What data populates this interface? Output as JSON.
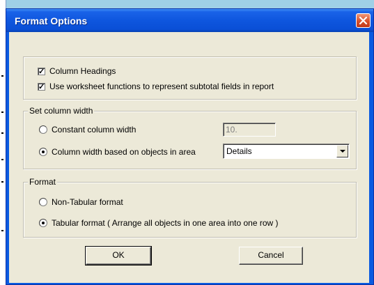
{
  "dialog": {
    "title": "Format Options"
  },
  "options": {
    "column_headings": {
      "label": "Column Headings",
      "checked": true
    },
    "worksheet_functions": {
      "label": "Use worksheet functions to represent subtotal fields in report",
      "checked": true
    }
  },
  "column_width": {
    "legend": "Set column width",
    "constant": {
      "label": "Constant column width",
      "selected": false,
      "value": "10."
    },
    "based_on_objects": {
      "label": "Column width based on objects in area",
      "selected": true,
      "selected_area": "Details"
    }
  },
  "format": {
    "legend": "Format",
    "non_tabular": {
      "label": "Non-Tabular format",
      "selected": false
    },
    "tabular": {
      "label": "Tabular format  ( Arrange all objects in one area into one row )",
      "selected": true
    }
  },
  "buttons": {
    "ok": "OK",
    "cancel": "Cancel"
  },
  "colors": {
    "titlebar": "#0a5ae0",
    "client": "#ece9d8",
    "close": "#d9502a"
  }
}
